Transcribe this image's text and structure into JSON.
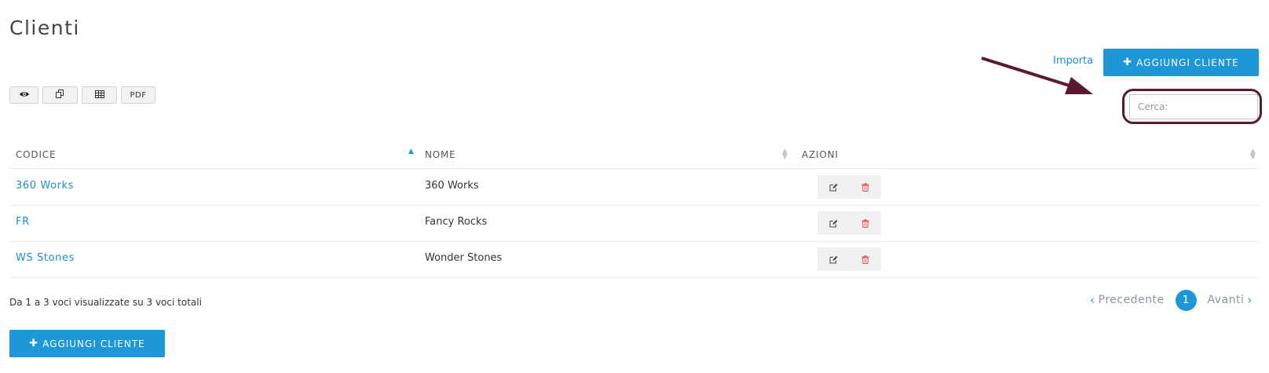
{
  "page": {
    "title": "Clienti"
  },
  "header": {
    "import_label": "Importa",
    "add_button": {
      "icon": "plus-icon",
      "label": "AGGIUNGI CLIENTE"
    }
  },
  "toolbar": {
    "buttons": [
      {
        "icon": "eye-icon"
      },
      {
        "icon": "copy-icon"
      },
      {
        "icon": "table-icon"
      },
      {
        "label": "PDF"
      }
    ]
  },
  "search": {
    "placeholder": "Cerca:",
    "value": ""
  },
  "table": {
    "columns": [
      {
        "label": "CODICE",
        "sort": "ascending"
      },
      {
        "label": "NOME",
        "sort": "none"
      },
      {
        "label": "AZIONI",
        "sort": "none"
      }
    ],
    "rows": [
      {
        "code": "360 Works",
        "name": "360 Works"
      },
      {
        "code": "FR",
        "name": "Fancy Rocks"
      },
      {
        "code": "WS Stones",
        "name": "Wonder Stones"
      }
    ],
    "row_actions": [
      {
        "icon": "edit-icon",
        "color": "#444444"
      },
      {
        "icon": "trash-icon",
        "color": "#e05555"
      }
    ]
  },
  "footer": {
    "info": "Da 1 a 3 voci visualizzate su 3 voci totali",
    "pagination": {
      "prev_label": "Precedente",
      "current_page": "1",
      "next_label": "Avanti"
    },
    "add_button": {
      "icon": "plus-icon",
      "label": "AGGIUNGI CLIENTE"
    }
  },
  "colors": {
    "accent": "#1d97d8",
    "link": "#1a8fd0",
    "annotation": "#5a1a35",
    "delete": "#e05555"
  }
}
